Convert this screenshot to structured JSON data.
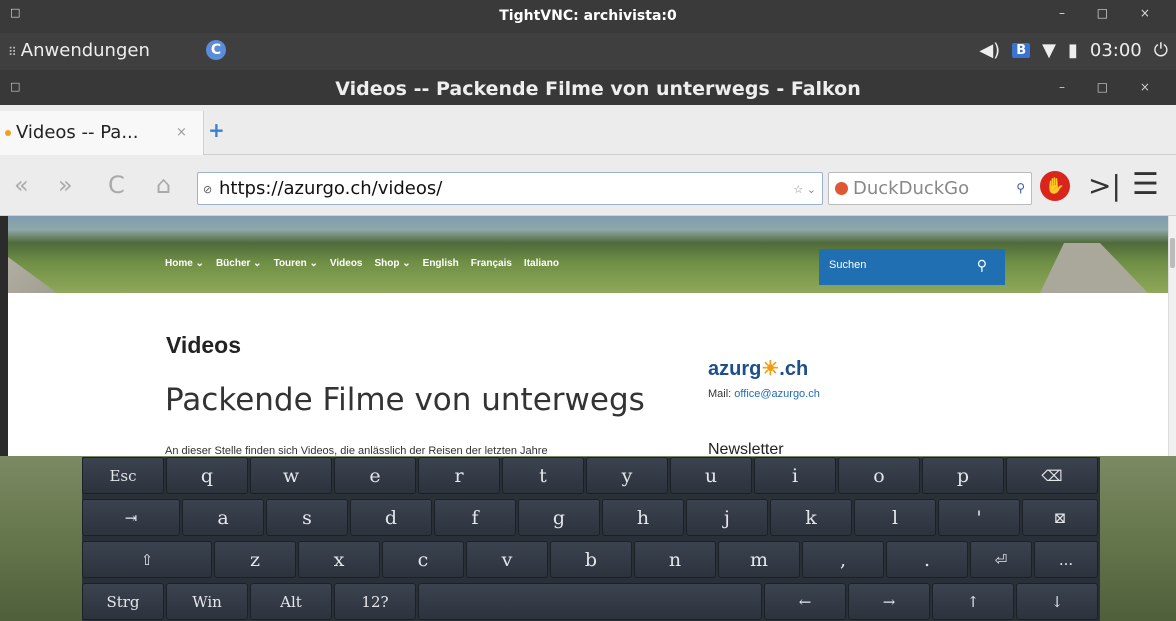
{
  "vnc": {
    "title": "TightVNC: archivista:0",
    "menu_icon": "□",
    "controls": "– □ ×"
  },
  "panel": {
    "apps_label": "Anwendungen",
    "apps_icon": "⠿",
    "refresh_icon": "C",
    "volume_icon": "◀)",
    "b_icon": "B",
    "wifi_icon": "▼",
    "battery_icon": "▮",
    "clock": "03:00",
    "power_icon": "⏻"
  },
  "falkon": {
    "title": "Videos -- Packende Filme von unterwegs - Falkon",
    "menu_icon": "□",
    "controls": "– □ ×"
  },
  "tab": {
    "label": "Videos -- Pa...",
    "close": "×",
    "new": "+"
  },
  "nav": {
    "back_icon": "«",
    "forward_icon": "»",
    "reload_icon": "C",
    "home_icon": "⌂",
    "url": "https://azurgo.ch/videos/",
    "lock_icon": "⊘",
    "star_icon": "☆ ⌄",
    "search_placeholder": "DuckDuckGo",
    "search_icon": "⚲",
    "adblock_icon": "✋",
    "sidebar_icon": ">|",
    "menu_icon": "☰"
  },
  "site": {
    "nav": [
      "Home ⌄",
      "Bücher ⌄",
      "Touren ⌄",
      "Videos",
      "Shop ⌄",
      "English",
      "Français",
      "Italiano"
    ],
    "search_placeholder": "Suchen",
    "search_icon": "⚲",
    "h1": "Videos",
    "h2": "Packende Filme von unterwegs",
    "para": "An dieser Stelle finden sich Videos, die anlässlich der Reisen der letzten Jahre",
    "brand_a": "azurg",
    "brand_sun": "☀",
    "brand_b": ".ch",
    "mail_label": "Mail: ",
    "mail_link": "office@azurgo.ch",
    "newsletter": "Newsletter"
  },
  "keyboard": {
    "row1": [
      "Esc",
      "q",
      "w",
      "e",
      "r",
      "t",
      "y",
      "u",
      "i",
      "o",
      "p",
      "⌫"
    ],
    "row2": [
      "⇥",
      "a",
      "s",
      "d",
      "f",
      "g",
      "h",
      "j",
      "k",
      "l",
      "'",
      "⊠"
    ],
    "row3": [
      "⇧",
      "z",
      "x",
      "c",
      "v",
      "b",
      "n",
      "m",
      ",",
      ".",
      "⏎",
      "..."
    ],
    "row4": [
      "Strg",
      "Win",
      "Alt",
      "12?",
      "",
      "←",
      "→",
      "↑",
      "↓"
    ]
  }
}
